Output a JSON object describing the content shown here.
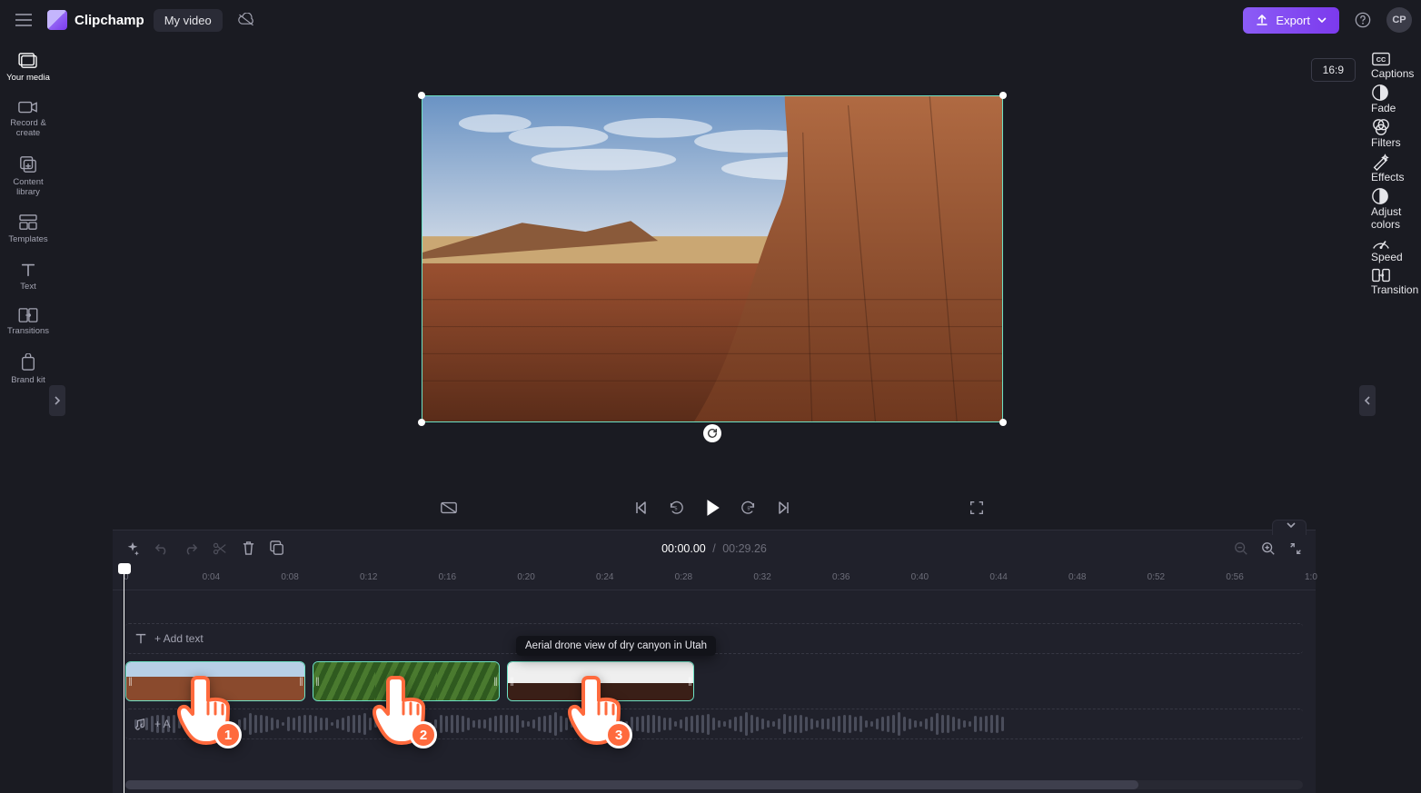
{
  "brand": {
    "name": "Clipchamp"
  },
  "header": {
    "project_title": "My video",
    "export_label": "Export",
    "avatar_initials": "CP"
  },
  "left_rail": {
    "items": [
      {
        "id": "your-media",
        "label": "Your media"
      },
      {
        "id": "record-create",
        "label": "Record & create"
      },
      {
        "id": "content-library",
        "label": "Content library"
      },
      {
        "id": "templates",
        "label": "Templates"
      },
      {
        "id": "text",
        "label": "Text"
      },
      {
        "id": "transitions",
        "label": "Transitions"
      },
      {
        "id": "brand-kit",
        "label": "Brand kit"
      }
    ]
  },
  "right_rail": {
    "items": [
      {
        "id": "captions",
        "label": "Captions"
      },
      {
        "id": "fade",
        "label": "Fade"
      },
      {
        "id": "filters",
        "label": "Filters"
      },
      {
        "id": "effects",
        "label": "Effects"
      },
      {
        "id": "adjust",
        "label": "Adjust colors"
      },
      {
        "id": "speed",
        "label": "Speed"
      },
      {
        "id": "transition",
        "label": "Transition"
      }
    ]
  },
  "stage": {
    "aspect_ratio": "16:9"
  },
  "timeline": {
    "current_time": "00:00.00",
    "duration": "00:29.26",
    "ruler": [
      "0",
      "0:04",
      "0:08",
      "0:12",
      "0:16",
      "0:20",
      "0:24",
      "0:28",
      "0:32",
      "0:36",
      "0:40",
      "0:44",
      "0:48",
      "0:52",
      "0:56",
      "1:0"
    ],
    "text_track": {
      "placeholder": "+ Add text"
    },
    "audio_track": {
      "placeholder": "+ A"
    },
    "clip_tooltip": "Aerial drone view of dry canyon in Utah"
  },
  "annotations": {
    "pointers": [
      {
        "num": "1"
      },
      {
        "num": "2"
      },
      {
        "num": "3"
      }
    ]
  }
}
